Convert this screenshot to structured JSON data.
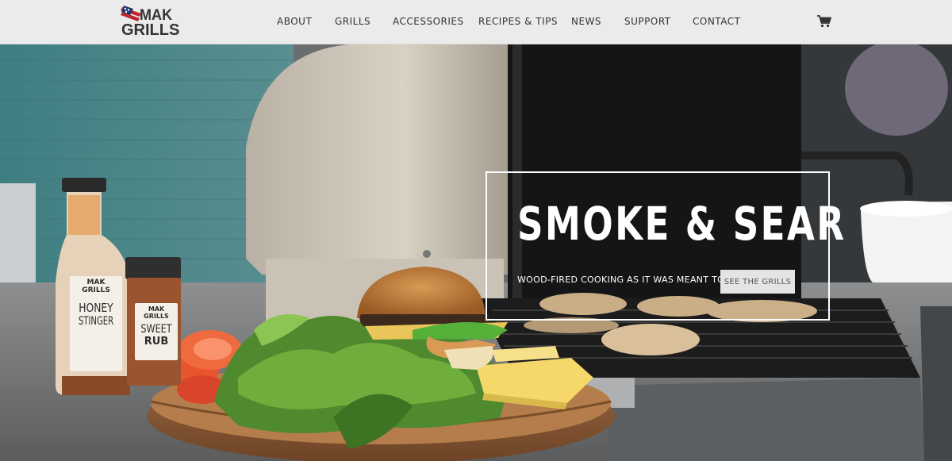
{
  "header": {
    "logo": {
      "line1": "MAK",
      "line2": "GRILLS"
    },
    "nav": [
      {
        "label": "ABOUT"
      },
      {
        "label": "GRILLS"
      },
      {
        "label": "ACCESSORIES"
      },
      {
        "label": "RECIPES & TIPS"
      },
      {
        "label": "NEWS"
      },
      {
        "label": "SUPPORT"
      },
      {
        "label": "CONTACT"
      }
    ],
    "cart_icon": "cart-icon"
  },
  "hero": {
    "title": "SMOKE & SEAR",
    "subtitle": "WOOD-FIRED COOKING AS IT WAS MEANT TO BE.",
    "button_label": "SEE THE GRILLS",
    "products": {
      "bottle": {
        "brand_top": "MAK",
        "brand_bottom": "GRILLS",
        "name_line1": "HONEY",
        "name_line2": "STINGER"
      },
      "jar": {
        "brand_top": "MAK",
        "brand_bottom": "GRILLS",
        "name_line1": "SWEET",
        "name_line2": "RUB"
      }
    }
  },
  "colors": {
    "header_bg": "#ebebeb",
    "nav_text": "#333333",
    "flag_red": "#c0272d",
    "flag_blue": "#1f3a6e",
    "hero_text": "#ffffff",
    "button_bg": "#e4e4e4"
  }
}
